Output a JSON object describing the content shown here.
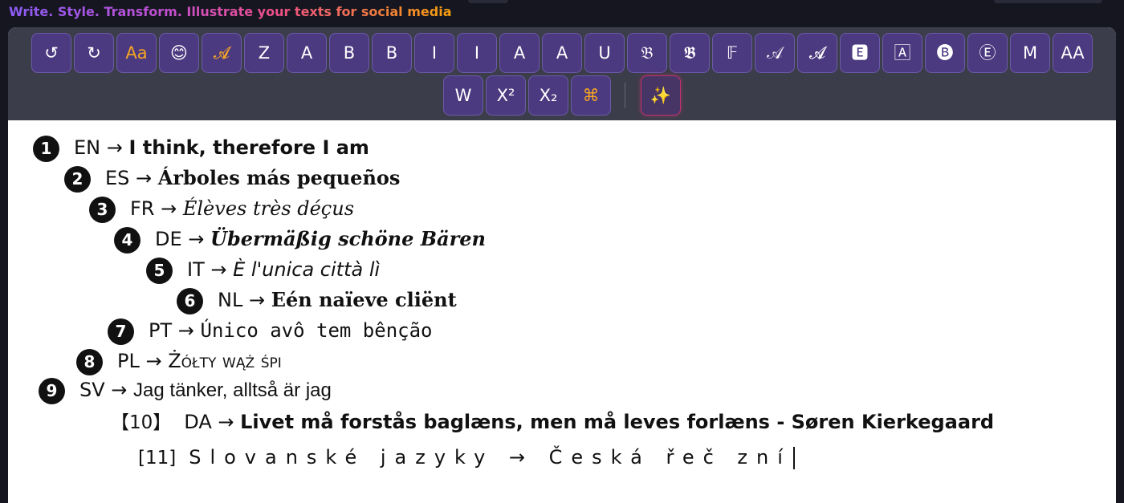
{
  "header": {
    "tagline": "Write. Style. Transform. Illustrate your texts for social media"
  },
  "toolbar": {
    "row1": [
      {
        "label": "↺",
        "name": "undo-button",
        "color": "white"
      },
      {
        "label": "↻",
        "name": "redo-button",
        "color": "white"
      },
      {
        "label": "Aa",
        "name": "case-button",
        "color": "orange"
      },
      {
        "label": "😊",
        "name": "emoji-button",
        "color": "white"
      },
      {
        "label": "𝓐",
        "name": "script-style-button",
        "color": "orange"
      },
      {
        "label": "Z",
        "name": "clear-format-button",
        "color": "white"
      },
      {
        "label": "A",
        "name": "sans-style-button",
        "color": "white"
      },
      {
        "label": "B",
        "name": "bold-sans-button",
        "color": "white"
      },
      {
        "label": "B",
        "name": "bold-serif-button",
        "color": "white"
      },
      {
        "label": "I",
        "name": "italic-sans-button",
        "color": "white"
      },
      {
        "label": "I",
        "name": "bold-italic-sans-button",
        "color": "white"
      },
      {
        "label": "A",
        "name": "italic-serif-button",
        "color": "white"
      },
      {
        "label": "A",
        "name": "bold-italic-serif-button",
        "color": "white"
      },
      {
        "label": "U",
        "name": "underline-button",
        "color": "white"
      },
      {
        "label": "𝔅",
        "name": "fraktur-button",
        "color": "white"
      },
      {
        "label": "𝕭",
        "name": "bold-fraktur-button",
        "color": "white"
      },
      {
        "label": "𝔽",
        "name": "double-struck-button",
        "color": "white"
      },
      {
        "label": "𝒜",
        "name": "script-button",
        "color": "white"
      },
      {
        "label": "𝓐",
        "name": "bold-script-button",
        "color": "white"
      },
      {
        "label": "🅴",
        "name": "squared-negative-button",
        "color": "white"
      },
      {
        "label": "🄰",
        "name": "squared-button",
        "color": "white"
      },
      {
        "label": "🅑",
        "name": "circled-negative-button",
        "color": "white"
      },
      {
        "label": "Ⓔ",
        "name": "circled-button",
        "color": "white"
      },
      {
        "label": "M",
        "name": "monospace-button",
        "color": "white"
      },
      {
        "label": "AA",
        "name": "uppercase-button",
        "color": "white"
      }
    ],
    "row2": [
      {
        "label": "W",
        "name": "wide-button",
        "color": "white"
      },
      {
        "label": "X²",
        "name": "superscript-button",
        "color": "white"
      },
      {
        "label": "X₂",
        "name": "subscript-button",
        "color": "white"
      },
      {
        "label": "⌘",
        "name": "symbols-button",
        "color": "orange"
      }
    ],
    "magic_label": "✨"
  },
  "editor": {
    "lines": [
      {
        "num": "❶",
        "lang": "EN →",
        "text": "I think, therefore I am"
      },
      {
        "num": "❷",
        "lang": "ES →",
        "text": "Árboles más pequeños"
      },
      {
        "num": "❸",
        "lang": "FR →",
        "text": "Élèves très déçus"
      },
      {
        "num": "❹",
        "lang": "DE →",
        "text": "Übermäßig schöne Bären"
      },
      {
        "num": "❺",
        "lang": "IT →",
        "text": "È l'unica città lì"
      },
      {
        "num": "❻",
        "lang": "NL →",
        "text": "Eén naïeve cliënt"
      },
      {
        "num": "❼",
        "lang": "PT →",
        "text": "Único avô tem bênção"
      },
      {
        "num": "❽",
        "lang": "PL →",
        "text": "Żółty wąż śpi"
      },
      {
        "num": "❾",
        "lang": "SV →",
        "text": "Jag tänker, alltså är jag"
      },
      {
        "num": "【10】",
        "lang": "DA →",
        "text": "Livet må forstås baglæns, men må leves forlæns - Søren Kierkegaard"
      },
      {
        "num": "[11]",
        "lang": "",
        "text": "Slovanské jazyky → Česká řeč zní"
      }
    ]
  }
}
